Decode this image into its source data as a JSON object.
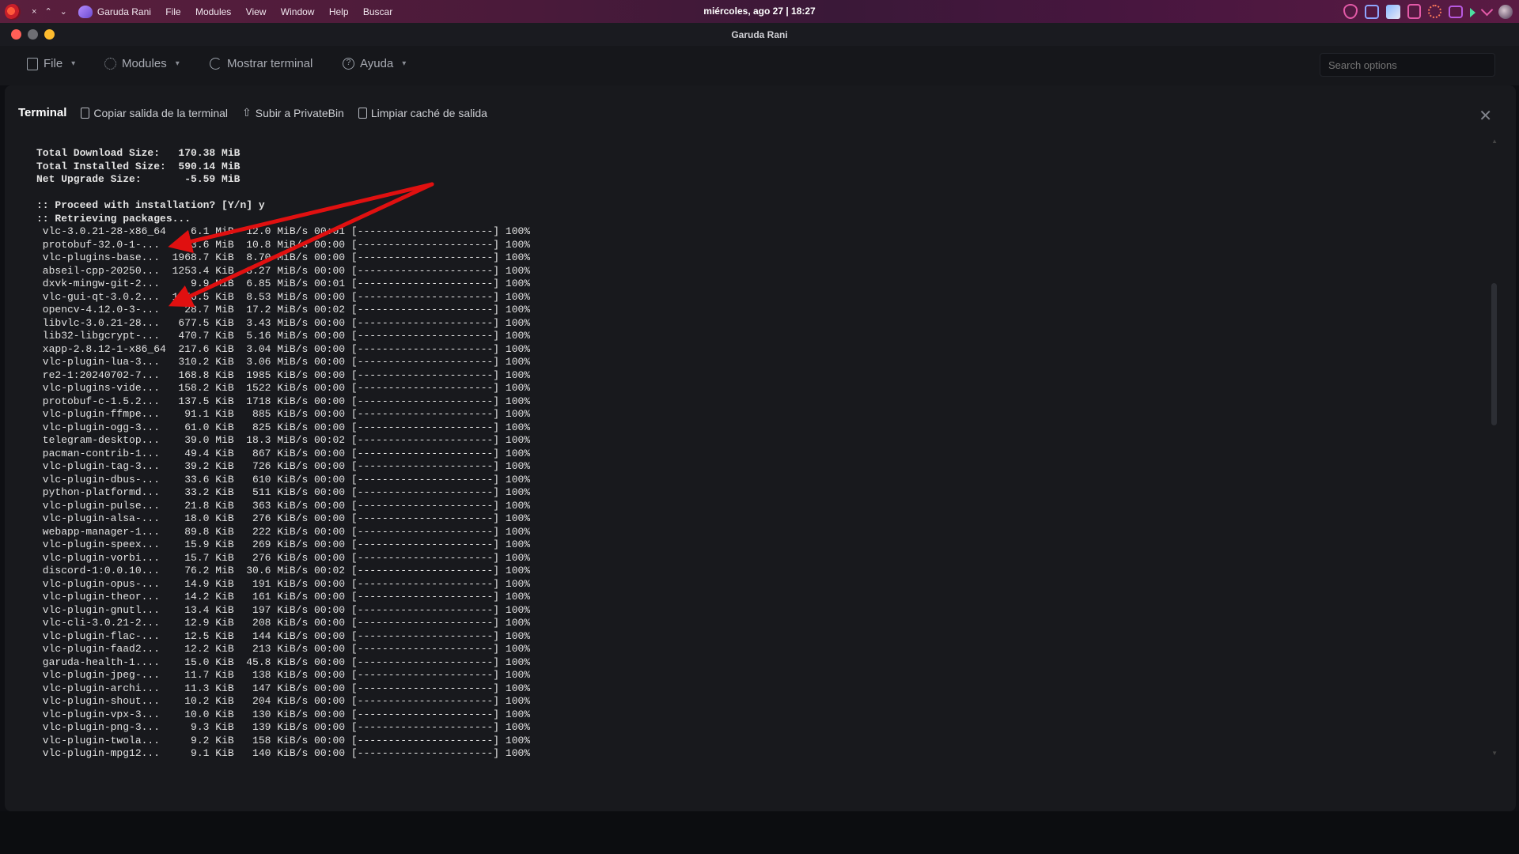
{
  "panel": {
    "controls": [
      "×",
      "⌃",
      "⌄"
    ],
    "app_name": "Garuda Rani",
    "menu": [
      "File",
      "Modules",
      "View",
      "Window",
      "Help",
      "Buscar"
    ],
    "clock": "miércoles, ago 27 | 18:27"
  },
  "window": {
    "title": "Garuda Rani"
  },
  "toolbar": {
    "file": "File",
    "modules": "Modules",
    "terminal": "Mostrar terminal",
    "help": "Ayuda",
    "search_placeholder": "Search options"
  },
  "terminal": {
    "title": "Terminal",
    "copy": "Copiar salida de la terminal",
    "upload": "Subir a PrivateBin",
    "clear": "Limpiar caché de salida",
    "lines": [
      "Total Download Size:   170.38 MiB",
      "Total Installed Size:  590.14 MiB",
      "Net Upgrade Size:       -5.59 MiB",
      "",
      ":: Proceed with installation? [Y/n] y",
      ":: Retrieving packages...",
      " vlc-3.0.21-28-x86_64    6.1 MiB  12.0 MiB/s 00:01 [----------------------] 100%",
      " protobuf-32.0-1-...     3.6 MiB  10.8 MiB/s 00:00 [----------------------] 100%",
      " vlc-plugins-base...  1968.7 KiB  8.70 MiB/s 00:00 [----------------------] 100%",
      " abseil-cpp-20250...  1253.4 KiB  8.27 MiB/s 00:00 [----------------------] 100%",
      " dxvk-mingw-git-2...     9.9 MiB  6.85 MiB/s 00:01 [----------------------] 100%",
      " vlc-gui-qt-3.0.2...  1256.5 KiB  8.53 MiB/s 00:00 [----------------------] 100%",
      " opencv-4.12.0-3-...    28.7 MiB  17.2 MiB/s 00:02 [----------------------] 100%",
      " libvlc-3.0.21-28...   677.5 KiB  3.43 MiB/s 00:00 [----------------------] 100%",
      " lib32-libgcrypt-...   470.7 KiB  5.16 MiB/s 00:00 [----------------------] 100%",
      " xapp-2.8.12-1-x86_64  217.6 KiB  3.04 MiB/s 00:00 [----------------------] 100%",
      " vlc-plugin-lua-3...   310.2 KiB  3.06 MiB/s 00:00 [----------------------] 100%",
      " re2-1:20240702-7...   168.8 KiB  1985 KiB/s 00:00 [----------------------] 100%",
      " vlc-plugins-vide...   158.2 KiB  1522 KiB/s 00:00 [----------------------] 100%",
      " protobuf-c-1.5.2...   137.5 KiB  1718 KiB/s 00:00 [----------------------] 100%",
      " vlc-plugin-ffmpe...    91.1 KiB   885 KiB/s 00:00 [----------------------] 100%",
      " vlc-plugin-ogg-3...    61.0 KiB   825 KiB/s 00:00 [----------------------] 100%",
      " telegram-desktop...    39.0 MiB  18.3 MiB/s 00:02 [----------------------] 100%",
      " pacman-contrib-1...    49.4 KiB   867 KiB/s 00:00 [----------------------] 100%",
      " vlc-plugin-tag-3...    39.2 KiB   726 KiB/s 00:00 [----------------------] 100%",
      " vlc-plugin-dbus-...    33.6 KiB   610 KiB/s 00:00 [----------------------] 100%",
      " python-platformd...    33.2 KiB   511 KiB/s 00:00 [----------------------] 100%",
      " vlc-plugin-pulse...    21.8 KiB   363 KiB/s 00:00 [----------------------] 100%",
      " vlc-plugin-alsa-...    18.0 KiB   276 KiB/s 00:00 [----------------------] 100%",
      " webapp-manager-1...    89.8 KiB   222 KiB/s 00:00 [----------------------] 100%",
      " vlc-plugin-speex...    15.9 KiB   269 KiB/s 00:00 [----------------------] 100%",
      " vlc-plugin-vorbi...    15.7 KiB   276 KiB/s 00:00 [----------------------] 100%",
      " discord-1:0.0.10...    76.2 MiB  30.6 MiB/s 00:02 [----------------------] 100%",
      " vlc-plugin-opus-...    14.9 KiB   191 KiB/s 00:00 [----------------------] 100%",
      " vlc-plugin-theor...    14.2 KiB   161 KiB/s 00:00 [----------------------] 100%",
      " vlc-plugin-gnutl...    13.4 KiB   197 KiB/s 00:00 [----------------------] 100%",
      " vlc-cli-3.0.21-2...    12.9 KiB   208 KiB/s 00:00 [----------------------] 100%",
      " vlc-plugin-flac-...    12.5 KiB   144 KiB/s 00:00 [----------------------] 100%",
      " vlc-plugin-faad2...    12.2 KiB   213 KiB/s 00:00 [----------------------] 100%",
      " garuda-health-1....    15.0 KiB  45.8 KiB/s 00:00 [----------------------] 100%",
      " vlc-plugin-jpeg-...    11.7 KiB   138 KiB/s 00:00 [----------------------] 100%",
      " vlc-plugin-archi...    11.3 KiB   147 KiB/s 00:00 [----------------------] 100%",
      " vlc-plugin-shout...    10.2 KiB   204 KiB/s 00:00 [----------------------] 100%",
      " vlc-plugin-vpx-3...    10.0 KiB   130 KiB/s 00:00 [----------------------] 100%",
      " vlc-plugin-png-3...     9.3 KiB   139 KiB/s 00:00 [----------------------] 100%",
      " vlc-plugin-twola...     9.2 KiB   158 KiB/s 00:00 [----------------------] 100%",
      " vlc-plugin-mpg12...     9.1 KiB   140 KiB/s 00:00 [----------------------] 100%"
    ]
  },
  "colors": {
    "annotation_arrow": "#e01010",
    "close_red": "#ff5f57",
    "minimize_gray": "#6e6e73",
    "maximize_yellow": "#febc2e"
  }
}
